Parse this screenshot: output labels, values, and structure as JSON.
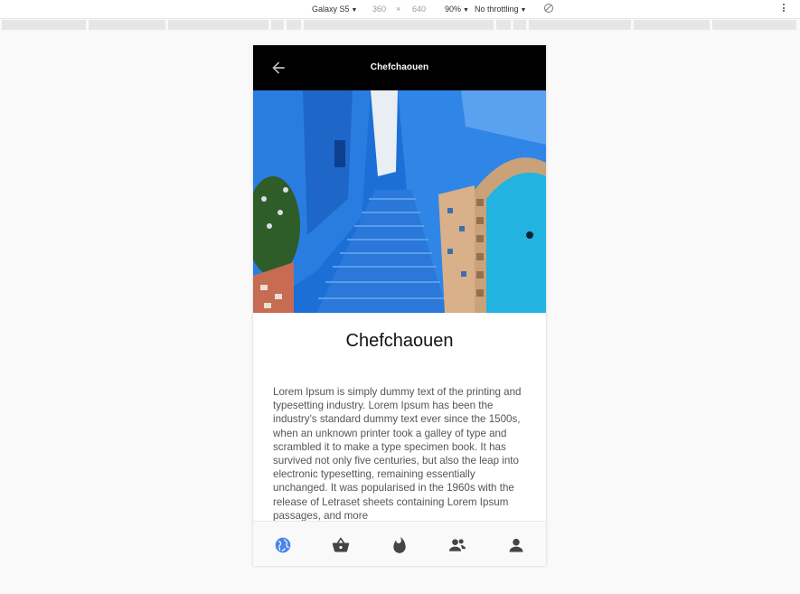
{
  "devtools": {
    "device": "Galaxy S5",
    "width": "360",
    "times": "×",
    "height": "640",
    "zoom": "90%",
    "throttling": "No throttling"
  },
  "app": {
    "title": "Chefchaouen",
    "heading": "Chefchaouen",
    "body": "Lorem Ipsum is simply dummy text of the printing and typesetting industry. Lorem Ipsum has been the industry's standard dummy text ever since the 1500s, when an unknown printer took a galley of type and scrambled it to make a type specimen book. It has survived not only five centuries, but also the leap into electronic typesetting, remaining essentially unchanged. It was popularised in the 1960s with the release of Letraset sheets containing Lorem Ipsum passages, and more",
    "active_color": "#4a86e8",
    "inactive_color": "#444444"
  },
  "bottom_nav": [
    {
      "icon": "globe-icon",
      "active": true
    },
    {
      "icon": "basket-icon",
      "active": false
    },
    {
      "icon": "fire-icon",
      "active": false
    },
    {
      "icon": "people-icon",
      "active": false
    },
    {
      "icon": "person-icon",
      "active": false
    }
  ]
}
